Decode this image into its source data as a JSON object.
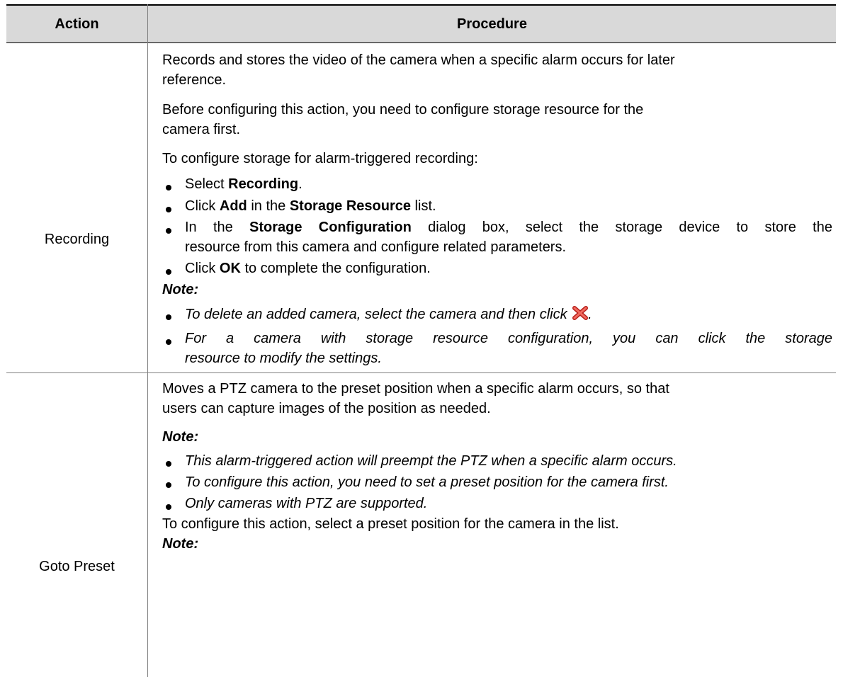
{
  "table": {
    "headers": {
      "action": "Action",
      "procedure": "Procedure"
    },
    "rows": [
      {
        "action": "Recording",
        "intro_1": "Records and stores the video of the camera when a specific alarm occurs for later",
        "intro_2": "reference.",
        "before_1": "Before configuring this action, you need to configure storage resource for the",
        "before_2": "camera first.",
        "to_configure": "To configure storage for alarm-triggered recording:",
        "steps": {
          "s1_a": "Select ",
          "s1_b": "Recording",
          "s1_c": ".",
          "s2_a": "Click ",
          "s2_b": "Add",
          "s2_c": " in the ",
          "s2_d": "Storage Resource",
          "s2_e": " list.",
          "s3_a": "In the ",
          "s3_b": "Storage Configuration",
          "s3_c": " dialog box, select the storage device to store the",
          "s3_line2": "resource from this camera and configure related parameters.",
          "s4_a": "Click ",
          "s4_b": "OK",
          "s4_c": " to complete the configuration."
        },
        "note_label": "Note:",
        "notes": {
          "n1": "To delete an added camera, select the camera and then click",
          "n1_end": ".",
          "n2_line1": "For a camera with storage resource configuration, you can click the storage",
          "n2_line2": "resource to modify the settings."
        }
      },
      {
        "action": "Goto Preset",
        "intro_1": "Moves a PTZ camera to the preset position when a specific alarm occurs, so that",
        "intro_2": "users can capture images of the position as needed.",
        "note_label": "Note:",
        "notes": {
          "n1": "This alarm-triggered action will preempt the PTZ when a specific alarm occurs.",
          "n2": "To configure this action, you need to set a preset position for the camera first.",
          "n3": "Only cameras with PTZ are supported."
        },
        "configure": "To configure this action, select a preset position for the camera in the list.",
        "note_label_2": "Note:"
      }
    ]
  },
  "icons": {
    "delete": "red-x-delete-icon"
  },
  "colors": {
    "header_bg": "#d9d9d9",
    "delete_icon": "#d9322b"
  }
}
